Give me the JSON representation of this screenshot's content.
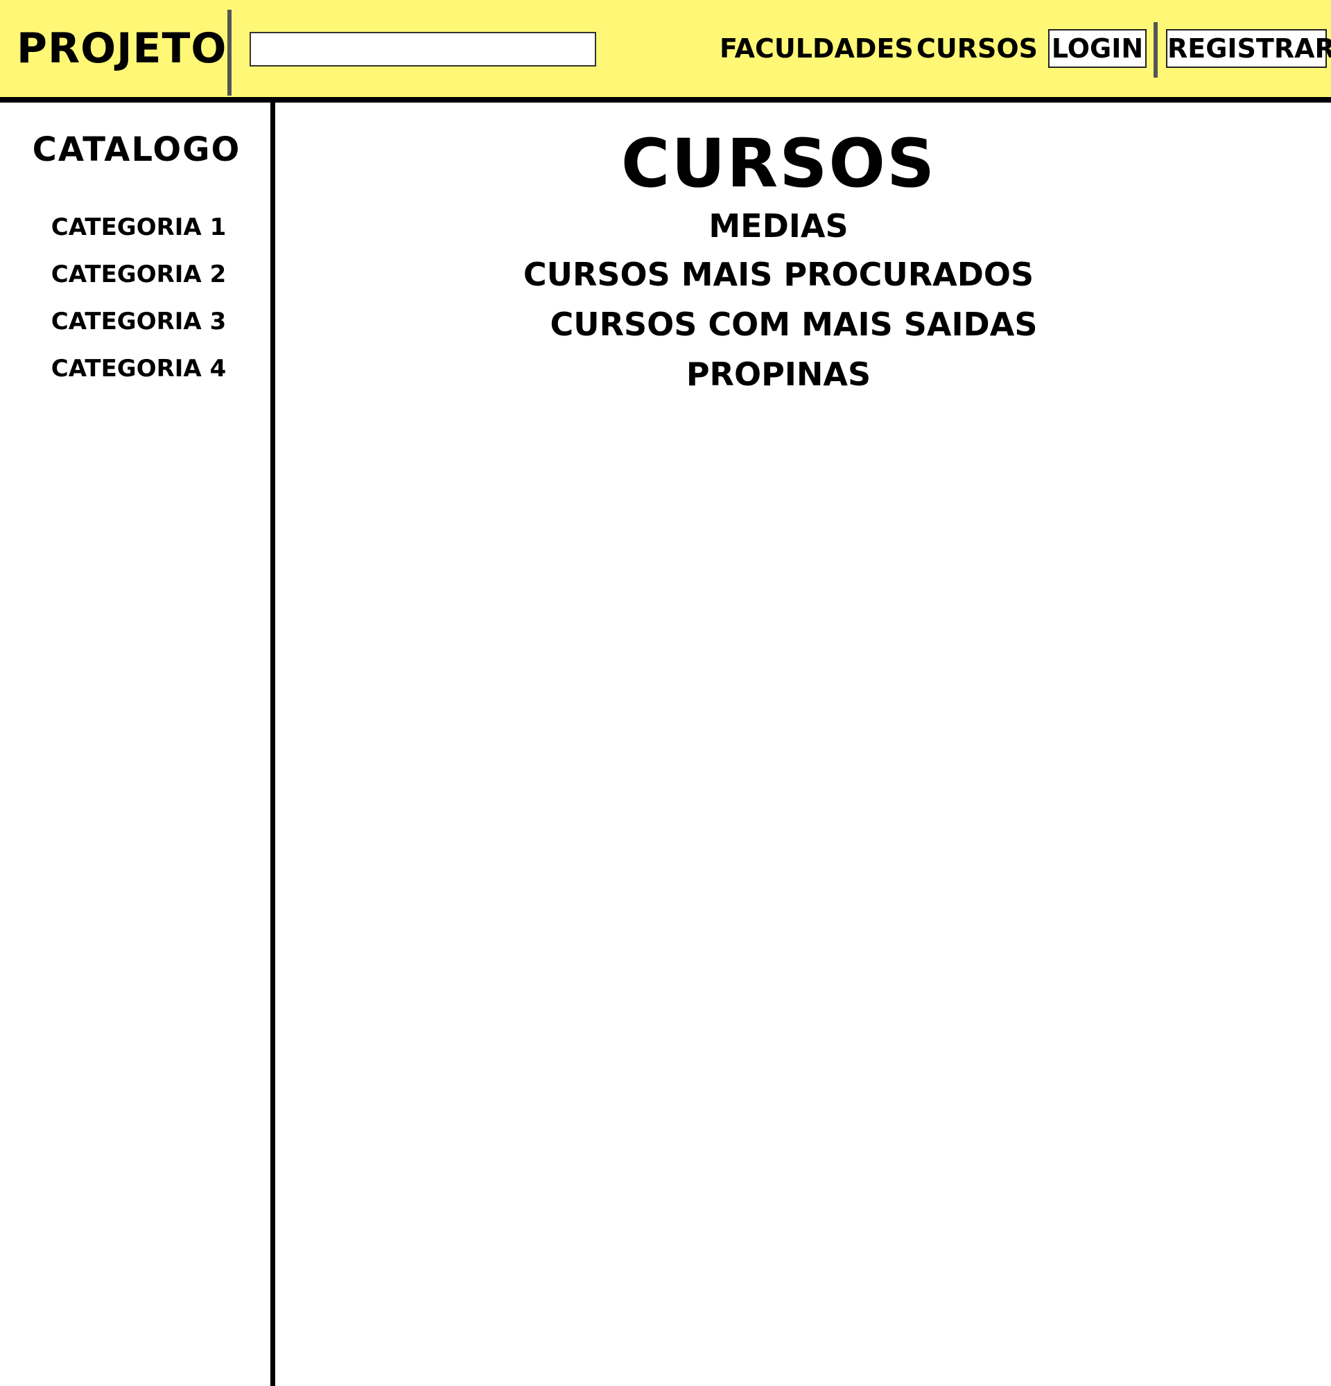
{
  "header": {
    "logo": "PROJETO",
    "search": {
      "value": "",
      "placeholder": ""
    },
    "nav": {
      "faculdades": "FACULDADES",
      "cursos": "CURSOS"
    },
    "buttons": {
      "login": "LOGIN",
      "registrar": "REGISTRAR"
    }
  },
  "sidebar": {
    "title": "CATALOGO",
    "items": [
      {
        "label": "CATEGORIA 1"
      },
      {
        "label": "CATEGORIA 2"
      },
      {
        "label": "CATEGORIA 3"
      },
      {
        "label": "CATEGORIA 4"
      }
    ]
  },
  "main": {
    "title": "CURSOS",
    "links": [
      {
        "label": "MEDIAS"
      },
      {
        "label": "CURSOS MAIS PROCURADOS"
      },
      {
        "label": "CURSOS COM MAIS SAIDAS"
      },
      {
        "label": "PROPINAS"
      }
    ]
  },
  "colors": {
    "header_background": "#fff876",
    "text": "#000000",
    "divider": "#555555",
    "page_background": "#ffffff"
  }
}
